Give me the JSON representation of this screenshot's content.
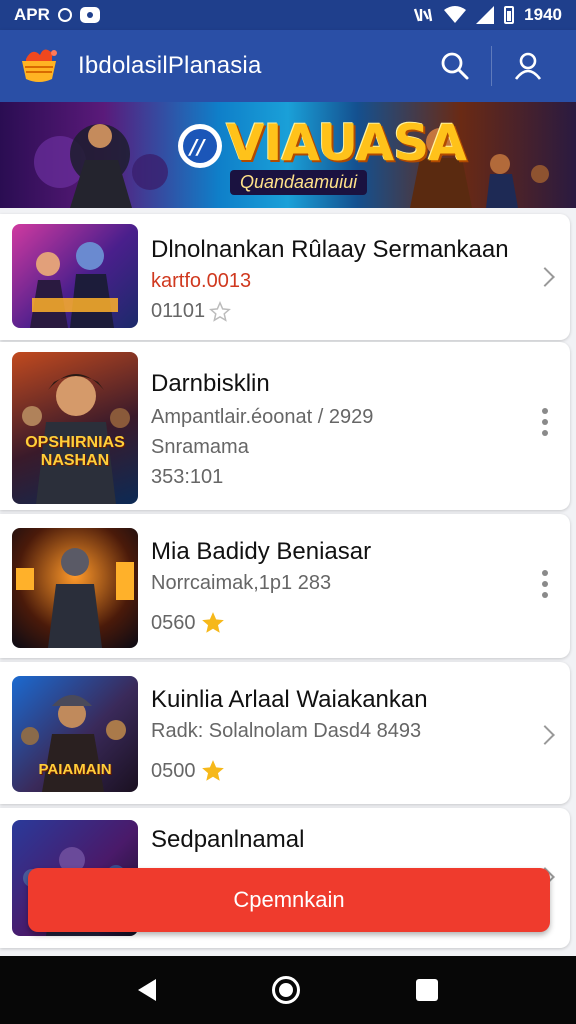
{
  "status_bar": {
    "left_text": "APR",
    "time": "1940"
  },
  "app_bar": {
    "title": "IbdolasilPlanasia",
    "icons": [
      "app-logo-icon",
      "search-icon",
      "account-icon"
    ]
  },
  "banner": {
    "title": "VIAUASA",
    "subtitle": "Quandaamuiui"
  },
  "items": [
    {
      "title": "Dlnolnankan Rûlaay Sermankaan",
      "meta": "kartfo.0013",
      "rating": "01101",
      "star_filled": false,
      "action_icon": "chevron-right-icon",
      "thumb_label": ""
    },
    {
      "title": "Darnbisklin",
      "meta": "Ampantlair.éoonat / 2929",
      "meta2": "Snramama",
      "rating": "353:101",
      "star_filled": null,
      "action_icon": "more-vert-icon",
      "thumb_label": "OPSHIRNIAS NASHAN"
    },
    {
      "title": "Mia Badidy Beniasar",
      "meta": "Norrcaimak,1p1 283",
      "rating": "0560",
      "star_filled": true,
      "action_icon": "more-vert-icon",
      "thumb_label": ""
    },
    {
      "title": "Kuinlia Arlaal Waiakankan",
      "meta": "Radk: Solalnolam Dasd4 8493",
      "rating": "0500",
      "star_filled": true,
      "action_icon": "chevron-right-icon",
      "thumb_label": "PAIAMAIN"
    },
    {
      "title": "Sedpanlnamal",
      "meta": "",
      "rating": "",
      "star_filled": null,
      "action_icon": "chevron-right-icon",
      "thumb_label": ""
    }
  ],
  "cta": {
    "label": "Cpemnkain"
  },
  "colors": {
    "status_bar": "#1f3f8c",
    "app_bar": "#2a4fa6",
    "cta": "#ef3b2d",
    "star": "#f6b81a",
    "nav_bar": "#070707"
  }
}
